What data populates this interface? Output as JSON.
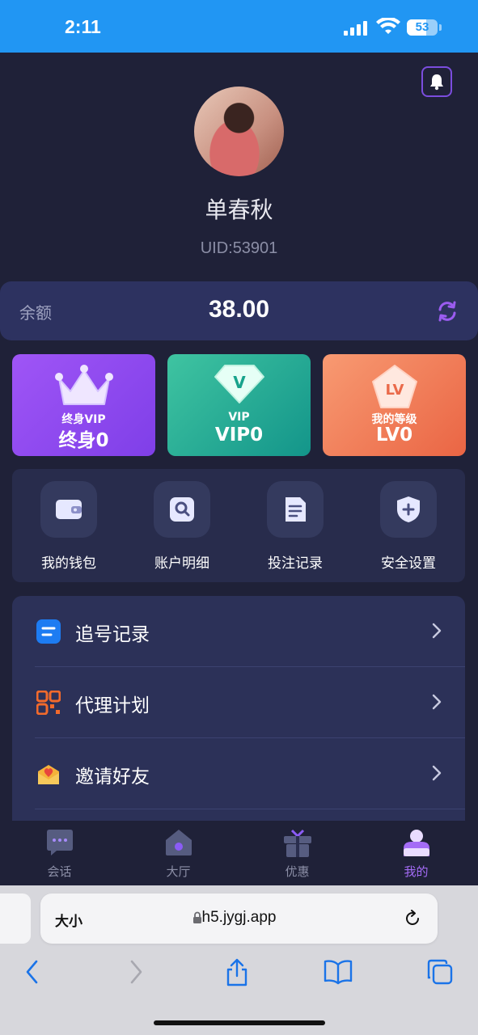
{
  "status_bar": {
    "time": "2:11",
    "battery": "53"
  },
  "profile": {
    "name": "单春秋",
    "uid": "UID:53901"
  },
  "balance": {
    "label": "余额",
    "value": "38.00"
  },
  "cards": [
    {
      "subtitle": "终身VIP",
      "value": "终身0",
      "icon": "crown-icon"
    },
    {
      "subtitle": "VIP",
      "value": "VIP0",
      "icon": "diamond-icon",
      "badge": "V"
    },
    {
      "subtitle": "我的等级",
      "value": "LV0",
      "icon": "level-badge-icon",
      "badge": "LV"
    }
  ],
  "quick_menu": [
    {
      "label": "我的钱包",
      "icon": "wallet-icon"
    },
    {
      "label": "账户明细",
      "icon": "search-doc-icon"
    },
    {
      "label": "投注记录",
      "icon": "document-icon"
    },
    {
      "label": "安全设置",
      "icon": "shield-icon"
    }
  ],
  "list": [
    {
      "label": "追号记录",
      "icon": "chase-record-icon"
    },
    {
      "label": "代理计划",
      "icon": "agent-plan-icon"
    },
    {
      "label": "邀请好友",
      "icon": "invite-icon"
    }
  ],
  "tabs": [
    {
      "label": "会话",
      "icon": "chat-icon",
      "active": false
    },
    {
      "label": "大厅",
      "icon": "home-icon",
      "active": false
    },
    {
      "label": "优惠",
      "icon": "gift-icon",
      "active": false
    },
    {
      "label": "我的",
      "icon": "user-icon",
      "active": true
    }
  ],
  "browser": {
    "text_size_label": "大小",
    "url": "h5.jygj.app"
  },
  "colors": {
    "accent": "#a46cf6",
    "background": "#1f2138",
    "status_bar": "#2196f3"
  }
}
